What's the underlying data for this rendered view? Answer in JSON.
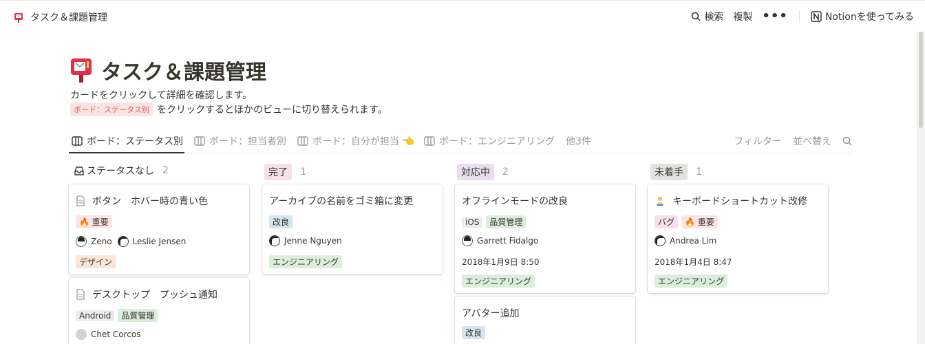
{
  "breadcrumb": {
    "title": "タスク＆課題管理"
  },
  "topbar": {
    "search": "検索",
    "duplicate": "複製",
    "more": "•••",
    "try_notion": "Notionを使ってみる"
  },
  "page": {
    "title": "タスク＆課題管理",
    "desc_line1": "カードをクリックして詳細を確認します。",
    "desc_code": "ボード：ステータス別",
    "desc_line2": "をクリックするとほかのビューに切り替えられます。"
  },
  "tabs": [
    {
      "label": "ボード：ステータス別"
    },
    {
      "label": "ボード：担当者別"
    },
    {
      "label": "ボード：自分が担当 👈"
    },
    {
      "label": "ボード：エンジニアリング"
    }
  ],
  "tabs_more": "他3件",
  "tools": {
    "filter": "フィルター",
    "sort": "並べ替え"
  },
  "columns": [
    {
      "label": "ステータスなし",
      "count": "2"
    },
    {
      "label": "完了",
      "count": "1"
    },
    {
      "label": "対応中",
      "count": "2"
    },
    {
      "label": "未着手",
      "count": "1"
    }
  ],
  "cards": {
    "c1": {
      "title": "ボタン　ホバー時の青い色",
      "tags": [
        "🔥 重要"
      ],
      "people": [
        "Zeno",
        "Leslie Jensen"
      ],
      "team": "デザイン"
    },
    "c2": {
      "title": "デスクトップ　プッシュ通知",
      "tags": [
        "Android",
        "品質管理"
      ],
      "people": [
        "Chet Corcos"
      ]
    },
    "c3": {
      "title": "アーカイブの名前をゴミ箱に変更",
      "tags": [
        "改良"
      ],
      "people": [
        "Jenne Nguyen"
      ],
      "team": "エンジニアリング"
    },
    "c4": {
      "title": "オフラインモードの改良",
      "tags": [
        "iOS",
        "品質管理"
      ],
      "people": [
        "Garrett Fidalgo"
      ],
      "date": "2018年1月9日 8:50",
      "team": "エンジニアリング"
    },
    "c5": {
      "title": "アバター追加",
      "tags": [
        "改良"
      ]
    },
    "c6": {
      "title": "キーボードショートカット改修",
      "tags": [
        "バグ",
        "🔥 重要"
      ],
      "people": [
        "Andrea Lim"
      ],
      "date": "2018年1月4日 8:47",
      "team": "エンジニアリング"
    }
  }
}
